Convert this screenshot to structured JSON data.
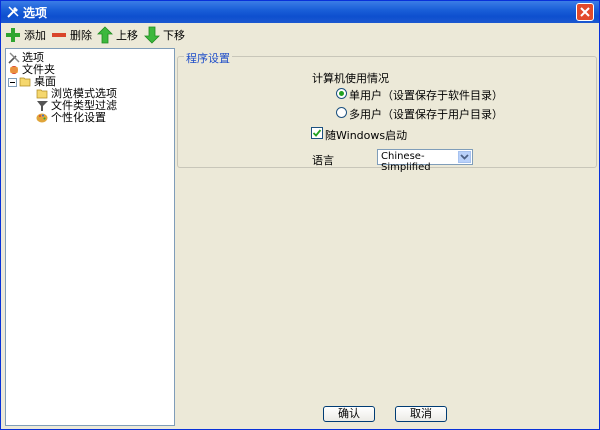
{
  "window": {
    "title": "选项"
  },
  "toolbar": {
    "add_label": "添加",
    "delete_label": "删除",
    "up_label": "上移",
    "down_label": "下移"
  },
  "tree": {
    "items": [
      {
        "label": "选项",
        "icon": "options-icon"
      },
      {
        "label": "文件夹",
        "icon": "folder-icon"
      },
      {
        "label": "桌面",
        "icon": "folder-open-icon"
      },
      {
        "label": "浏览模式选项",
        "icon": "folder-open-icon"
      },
      {
        "label": "文件类型过滤",
        "icon": "filter-icon"
      },
      {
        "label": "个性化设置",
        "icon": "palette-icon"
      }
    ]
  },
  "settings": {
    "group_title": "程序设置",
    "usage_title": "计算机使用情况",
    "single_user": "单用户（设置保存于软件目录）",
    "multi_user": "多用户（设置保存于用户目录）",
    "startup_checkbox": "随Windows启动",
    "language_label": "语言",
    "language_value": "Chinese-Simplified"
  },
  "buttons": {
    "ok": "确认",
    "cancel": "取消"
  },
  "colors": {
    "title_bar": "#0d4fcf",
    "legend_text": "#1f4ec9",
    "close_button": "#e24a2b"
  }
}
